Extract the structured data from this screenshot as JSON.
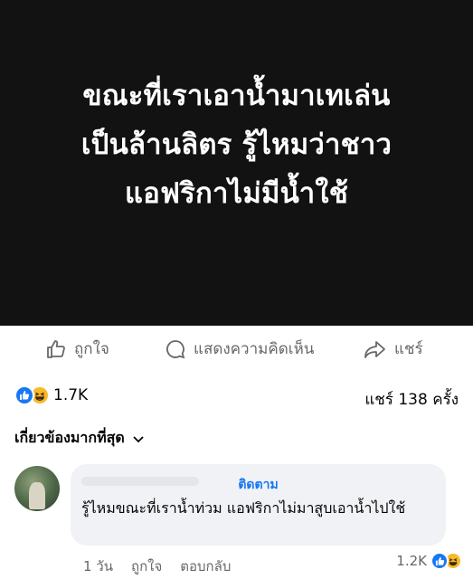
{
  "post": {
    "image_text": "ขณะที่เราเอาน้ำมาเทเล่น\nเป็นล้านลิตร รู้ไหมว่าชาว\nแอฟริกาไม่มีน้ำใช้"
  },
  "actions": {
    "like_label": "ถูกใจ",
    "comment_label": "แสดงความคิดเห็น",
    "share_label": "แชร์"
  },
  "stats": {
    "reaction_count": "1.7K",
    "share_count": "แชร์ 138 ครั้ง"
  },
  "comments": {
    "sort_label": "เกี่ยวข้องมากที่สุด",
    "items": [
      {
        "follow_label": "ติดตาม",
        "text": "รู้ไหมขณะที่เราน้ำท่วม แอฟริกาไม่มาสูบเอาน้ำไปใช้",
        "time": "1 วัน",
        "like_label": "ถูกใจ",
        "reply_label": "ตอบกลับ",
        "reaction_count": "1.2K"
      }
    ]
  },
  "colors": {
    "accent": "#1877f2",
    "secondary_text": "#65676b",
    "image_bg": "#121212"
  },
  "icons": [
    "thumbs-up-icon",
    "comment-icon",
    "share-arrow-icon",
    "like-reaction-icon",
    "haha-reaction-icon",
    "chevron-down-icon"
  ]
}
